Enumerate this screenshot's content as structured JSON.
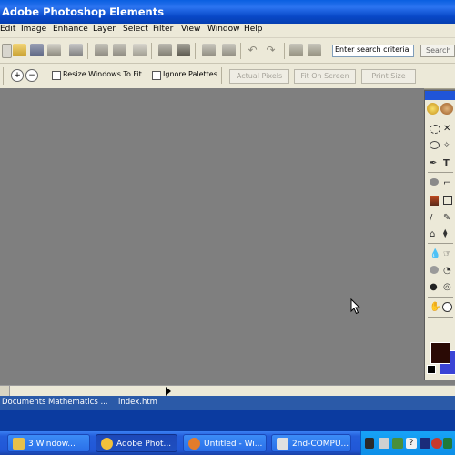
{
  "window": {
    "title": "Adobe Photoshop Elements"
  },
  "menu": {
    "items": [
      "Edit",
      "Image",
      "Enhance",
      "Layer",
      "Select",
      "Filter",
      "View",
      "Window",
      "Help"
    ]
  },
  "toolbar": {
    "icons": [
      "new-file-icon",
      "open-icon",
      "save-icon",
      "print-icon",
      "web-save-icon",
      "save-as-icon",
      "print-preview-icon",
      "email-icon",
      "step-backward-icon",
      "step-forward-icon",
      "undo-icon",
      "redo-icon",
      "quick-fix-icon",
      "palette-icon",
      "help-icon"
    ],
    "search_placeholder": "Enter search criteria",
    "search_button": "Search"
  },
  "options": {
    "resize_windows": "Resize Windows To Fit",
    "ignore_palettes": "Ignore Palettes",
    "actual_pixels": "Actual Pixels",
    "fit_on_screen": "Fit On Screen",
    "print_size": "Print Size"
  },
  "docbar": {
    "items": [
      "Documents",
      "Mathematics ...",
      "index.htm"
    ]
  },
  "taskbar": {
    "tasks": [
      {
        "label": "3 Window...",
        "icon": "folder-icon",
        "color": "#e8c04a"
      },
      {
        "label": "Adobe Phot...",
        "icon": "photoshop-icon",
        "color": "#f2c13b"
      },
      {
        "label": "Untitled - Wi...",
        "icon": "paint-icon",
        "color": "#e37c2c"
      },
      {
        "label": "2nd-COMPU...",
        "icon": "word-doc-icon",
        "color": "#e0e0e0"
      }
    ],
    "tray_icons": [
      "pen-tool-icon",
      "network-icon",
      "monitor-icon",
      "help-tray-icon",
      "arrow-tray-icon",
      "browser-tray-icon",
      "volume-icon"
    ]
  },
  "colors": {
    "foreground": "#2a0a05",
    "background": "#3a44d6",
    "workspace": "#7f7f7f"
  }
}
